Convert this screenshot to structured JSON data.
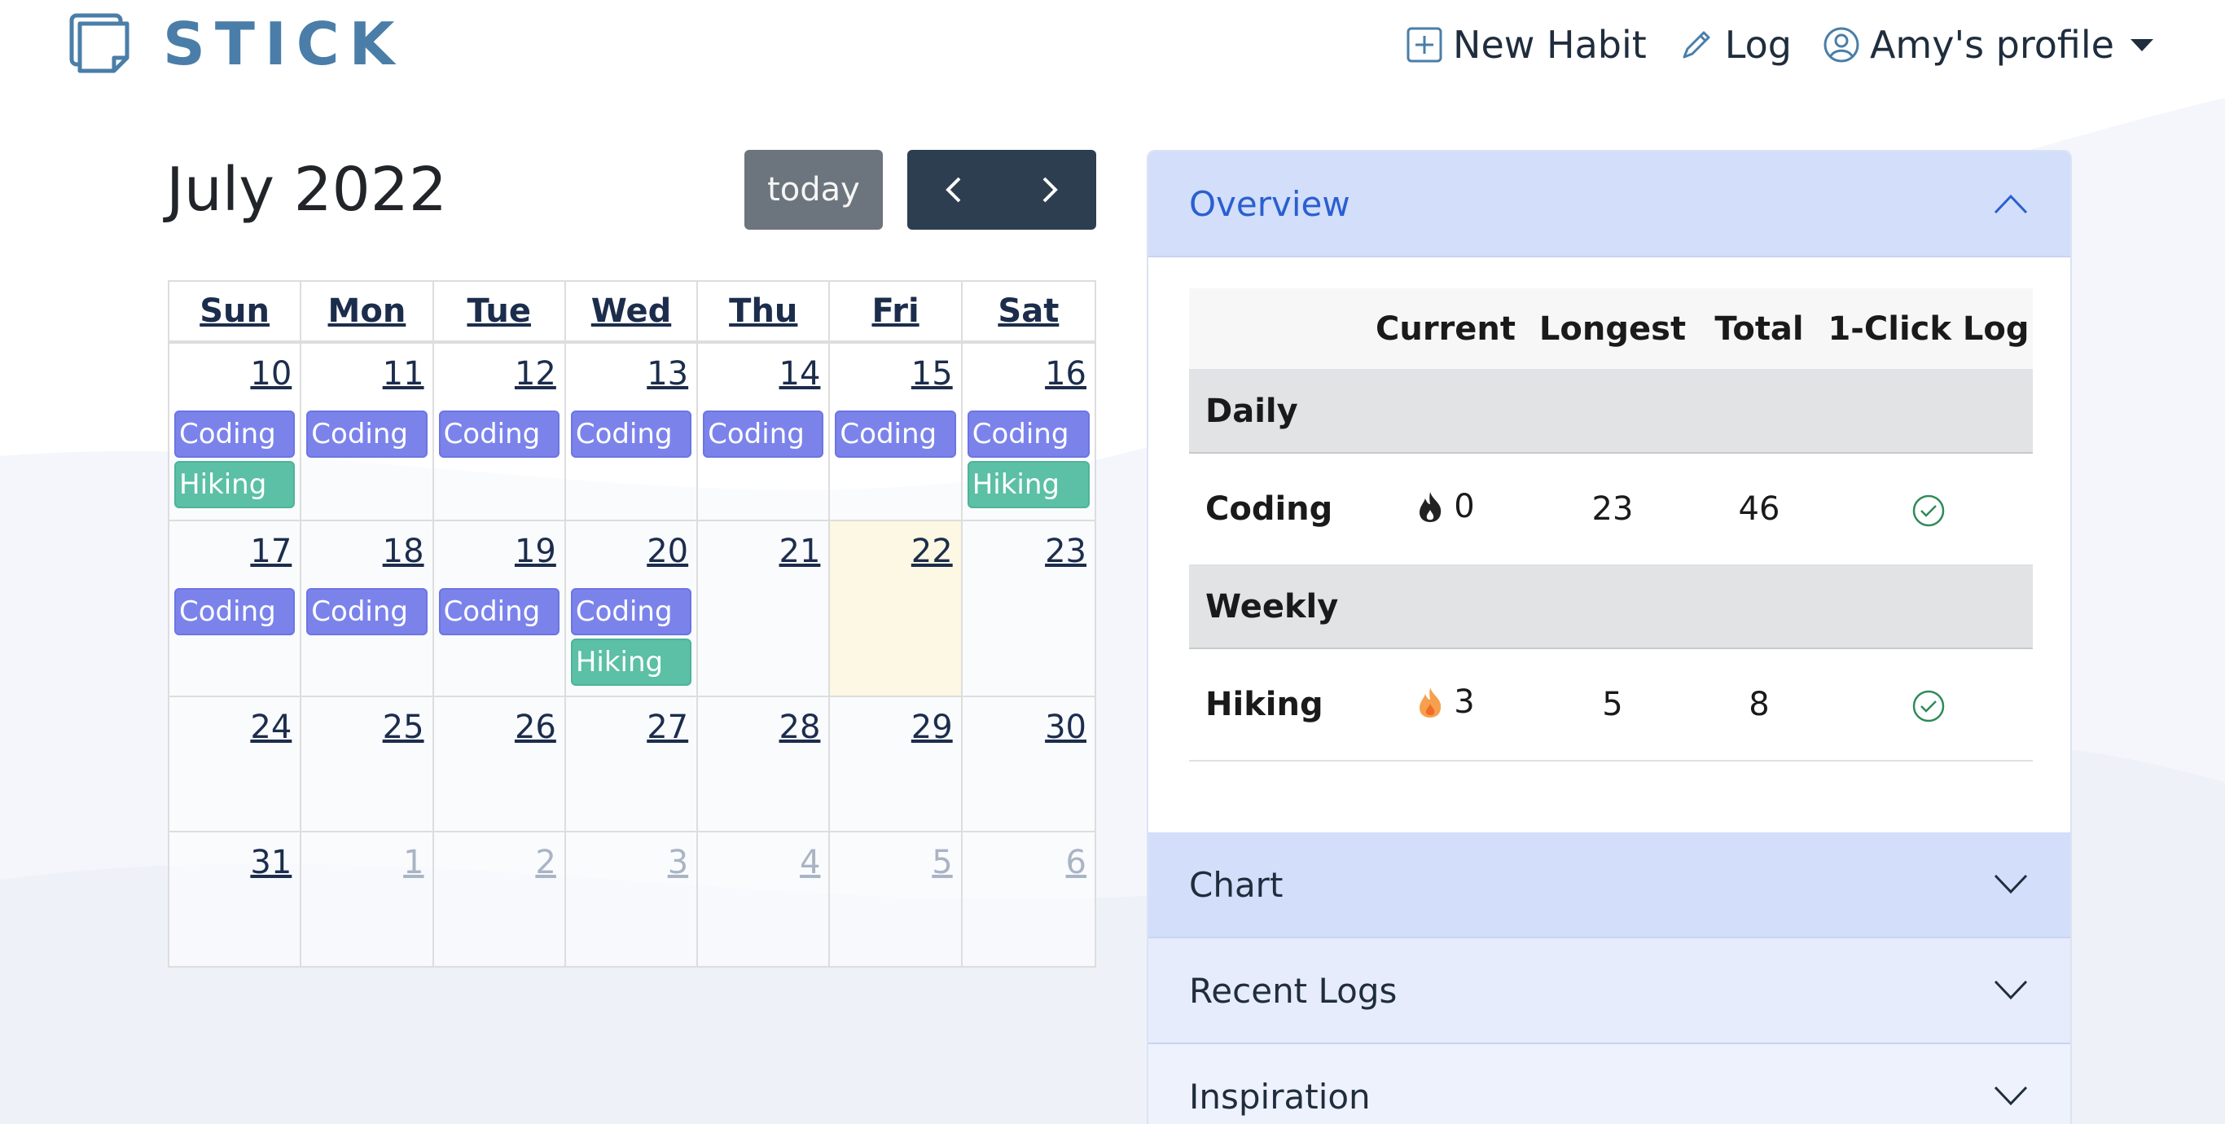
{
  "brand": {
    "name": "STICK"
  },
  "nav": {
    "new_habit": "New Habit",
    "log": "Log",
    "profile": "Amy's profile"
  },
  "calendar": {
    "title": "July 2022",
    "today_button": "today",
    "weekdays": [
      "Sun",
      "Mon",
      "Tue",
      "Wed",
      "Thu",
      "Fri",
      "Sat"
    ],
    "weeks": [
      [
        {
          "n": "10",
          "events": [
            "Coding",
            "Hiking"
          ]
        },
        {
          "n": "11",
          "events": [
            "Coding"
          ]
        },
        {
          "n": "12",
          "events": [
            "Coding"
          ]
        },
        {
          "n": "13",
          "events": [
            "Coding"
          ]
        },
        {
          "n": "14",
          "events": [
            "Coding"
          ]
        },
        {
          "n": "15",
          "events": [
            "Coding"
          ]
        },
        {
          "n": "16",
          "events": [
            "Coding",
            "Hiking"
          ]
        }
      ],
      [
        {
          "n": "17",
          "events": [
            "Coding"
          ]
        },
        {
          "n": "18",
          "events": [
            "Coding"
          ]
        },
        {
          "n": "19",
          "events": [
            "Coding"
          ]
        },
        {
          "n": "20",
          "events": [
            "Coding",
            "Hiking"
          ]
        },
        {
          "n": "21",
          "events": []
        },
        {
          "n": "22",
          "events": [],
          "today": true
        },
        {
          "n": "23",
          "events": []
        }
      ],
      [
        {
          "n": "24",
          "events": []
        },
        {
          "n": "25",
          "events": []
        },
        {
          "n": "26",
          "events": []
        },
        {
          "n": "27",
          "events": []
        },
        {
          "n": "28",
          "events": []
        },
        {
          "n": "29",
          "events": []
        },
        {
          "n": "30",
          "events": []
        }
      ],
      [
        {
          "n": "31",
          "events": []
        },
        {
          "n": "1",
          "events": [],
          "other": true
        },
        {
          "n": "2",
          "events": [],
          "other": true
        },
        {
          "n": "3",
          "events": [],
          "other": true
        },
        {
          "n": "4",
          "events": [],
          "other": true
        },
        {
          "n": "5",
          "events": [],
          "other": true
        },
        {
          "n": "6",
          "events": [],
          "other": true
        }
      ]
    ]
  },
  "panel": {
    "overview": {
      "title": "Overview",
      "columns": [
        "",
        "Current",
        "Longest",
        "Total",
        "1-Click Log"
      ],
      "groups": [
        {
          "label": "Daily",
          "rows": [
            {
              "name": "Coding",
              "current": "0",
              "longest": "23",
              "total": "46",
              "flame": "dark"
            }
          ]
        },
        {
          "label": "Weekly",
          "rows": [
            {
              "name": "Hiking",
              "current": "3",
              "longest": "5",
              "total": "8",
              "flame": "orange"
            }
          ]
        }
      ]
    },
    "sections": [
      "Chart",
      "Recent Logs",
      "Inspiration"
    ]
  },
  "colors": {
    "brand": "#4a7ea8",
    "coding_event": "#7b83eb",
    "hiking_event": "#5bc0a5",
    "accordion_header": "#d3defa",
    "today_cell": "#fcf8e3",
    "check": "#2e8b57"
  }
}
